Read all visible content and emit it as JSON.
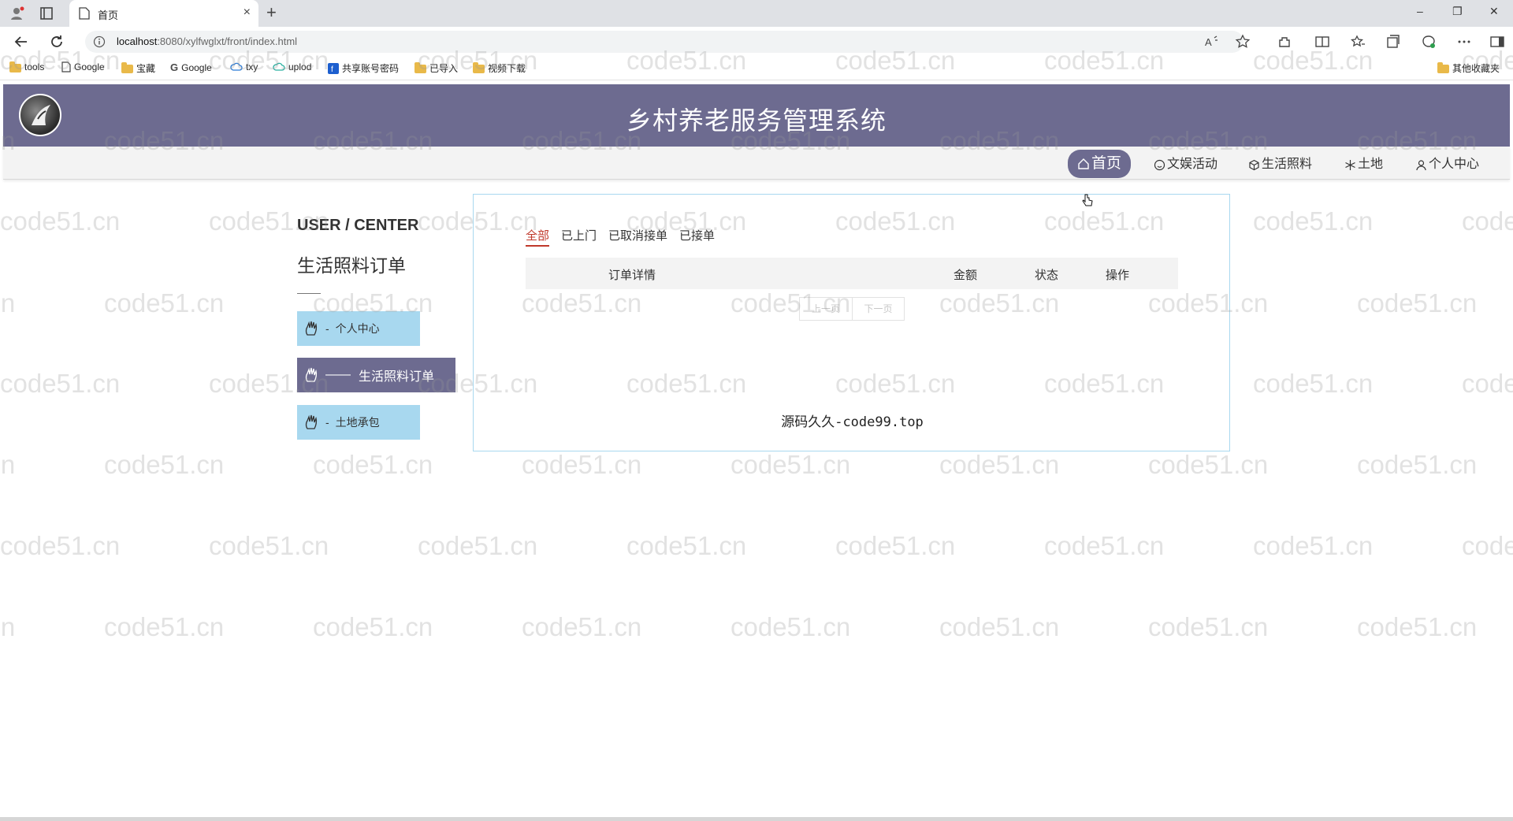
{
  "browser": {
    "tab_title": "首页",
    "tab_close": "×",
    "new_tab": "+",
    "url_host": "localhost",
    "url_path": ":8080/xylfwglxt/front/index.html",
    "window_controls": {
      "minimize": "–",
      "restore": "❐",
      "close": "✕"
    },
    "bookmarks": [
      {
        "label": "tools",
        "icon": "folder-icon"
      },
      {
        "label": "Google",
        "icon": "page-icon"
      },
      {
        "label": "宝藏",
        "icon": "folder-icon"
      },
      {
        "label": "Google",
        "icon": "google-icon"
      },
      {
        "label": "txy",
        "icon": "cloud-icon"
      },
      {
        "label": "uplod",
        "icon": "cloud-icon"
      },
      {
        "label": "共享账号密码",
        "icon": "brand-icon"
      },
      {
        "label": "已导入",
        "icon": "folder-icon"
      },
      {
        "label": "视频下载",
        "icon": "folder-icon"
      }
    ],
    "other_bookmarks": "其他收藏夹"
  },
  "site": {
    "title": "乡村养老服务管理系统",
    "nav": [
      {
        "label": "首页",
        "icon": "home-icon",
        "active": true
      },
      {
        "label": "文娱活动",
        "icon": "smile-icon"
      },
      {
        "label": "生活照料",
        "icon": "cube-icon"
      },
      {
        "label": "土地",
        "icon": "snowflake-icon"
      },
      {
        "label": "个人中心",
        "icon": "user-icon"
      }
    ]
  },
  "sidebar": {
    "heading_en": "USER / CENTER",
    "heading_cn": "生活照料订单",
    "items": [
      {
        "label": "个人中心",
        "prefix": "-",
        "style": "light"
      },
      {
        "label": "生活照料订单",
        "prefix": "——",
        "style": "dark"
      },
      {
        "label": "土地承包",
        "prefix": "-",
        "style": "light"
      }
    ]
  },
  "orders": {
    "filters": [
      {
        "label": "全部",
        "active": true
      },
      {
        "label": "已上门"
      },
      {
        "label": "已取消接单"
      },
      {
        "label": "已接单"
      }
    ],
    "columns": [
      "订单详情",
      "金额",
      "状态",
      "操作"
    ],
    "rows": [],
    "pager": {
      "prev": "上一页",
      "next": "下一页"
    },
    "footer": "源码久久-code99.top"
  },
  "watermark_text": "code51.cn",
  "colors": {
    "header_bg": "#6d6b90",
    "side_light": "#a8d8ef",
    "filter_active": "#c0392b"
  }
}
